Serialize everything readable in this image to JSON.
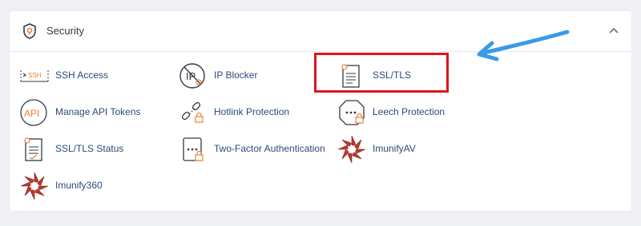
{
  "section": {
    "title": "Security",
    "icon": "shield-icon",
    "collapse_icon": "chevron-up-icon"
  },
  "items": [
    {
      "label": "SSH Access",
      "icon": "ssh-terminal-icon"
    },
    {
      "label": "IP Blocker",
      "icon": "ip-blocker-icon"
    },
    {
      "label": "SSL/TLS",
      "icon": "certificate-icon"
    },
    {
      "label": "Manage API Tokens",
      "icon": "api-icon"
    },
    {
      "label": "Hotlink Protection",
      "icon": "broken-link-lock-icon"
    },
    {
      "label": "Leech Protection",
      "icon": "octagon-lock-icon"
    },
    {
      "label": "SSL/TLS Status",
      "icon": "certificate-status-icon"
    },
    {
      "label": "Two-Factor Authentication",
      "icon": "phone-lock-icon"
    },
    {
      "label": "ImunifyAV",
      "icon": "imunify-icon"
    },
    {
      "label": "Imunify360",
      "icon": "imunify360-icon"
    }
  ],
  "colors": {
    "accent_orange": "#e8833a",
    "link_blue": "#2c4a7a",
    "highlight_red": "#e0151b",
    "arrow_blue": "#3b9ae8"
  }
}
